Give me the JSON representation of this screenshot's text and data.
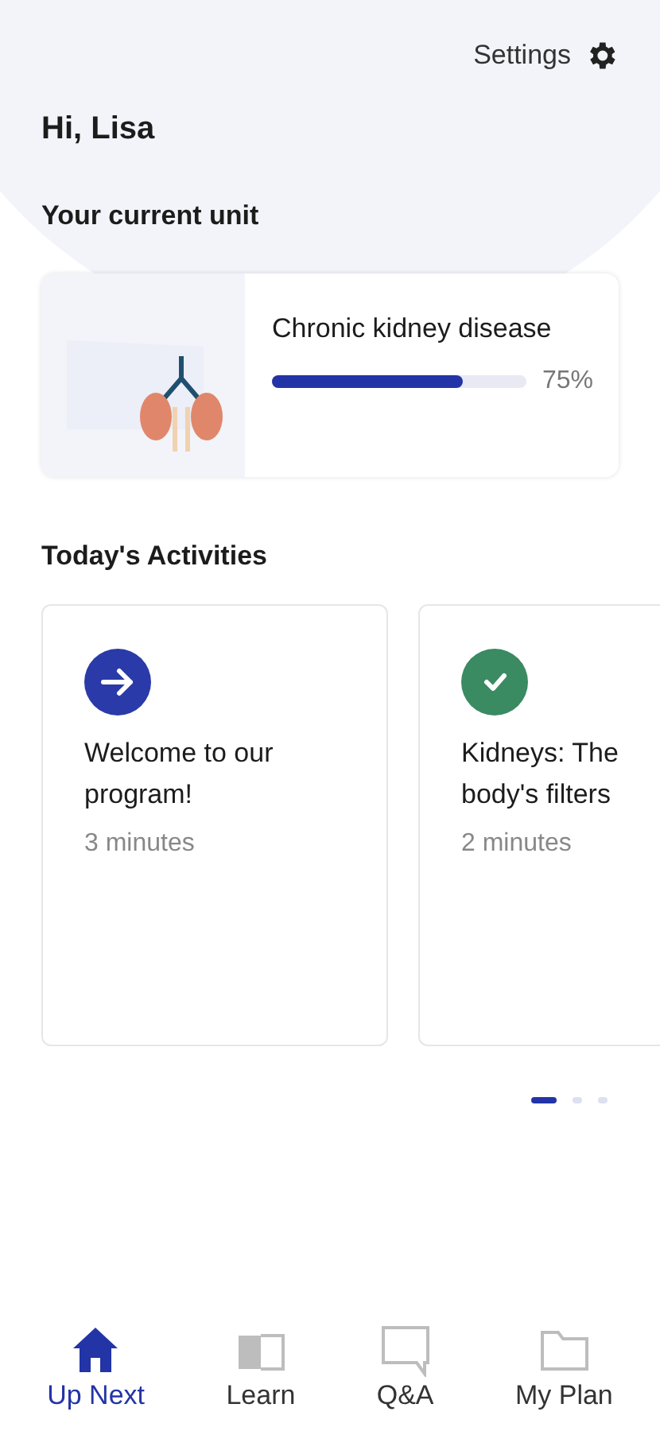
{
  "header": {
    "settings_label": "Settings",
    "greeting": "Hi, Lisa"
  },
  "current_unit": {
    "heading": "Your current unit",
    "title": "Chronic kidney disease",
    "level": 0.75,
    "reading": "75%"
  },
  "activities": {
    "heading": "Today's Activities",
    "items": [
      {
        "kind": "arrow",
        "color": "#2a3aa8",
        "title": "Welcome to our program!",
        "duration": "3 minutes"
      },
      {
        "kind": "check",
        "color": "#3a8a62",
        "title": "Kidneys: The body's filters",
        "duration": "2 minutes"
      }
    ],
    "pager": [
      {
        "selected": true
      },
      {
        "selected": false
      },
      {
        "selected": false
      }
    ]
  },
  "nav": [
    {
      "kind": "home",
      "label": "Up Next",
      "selected": true
    },
    {
      "kind": "book",
      "label": "Learn",
      "selected": false
    },
    {
      "kind": "chat",
      "label": "Q&A",
      "selected": false
    },
    {
      "kind": "folder",
      "label": "My Plan",
      "selected": false
    }
  ]
}
